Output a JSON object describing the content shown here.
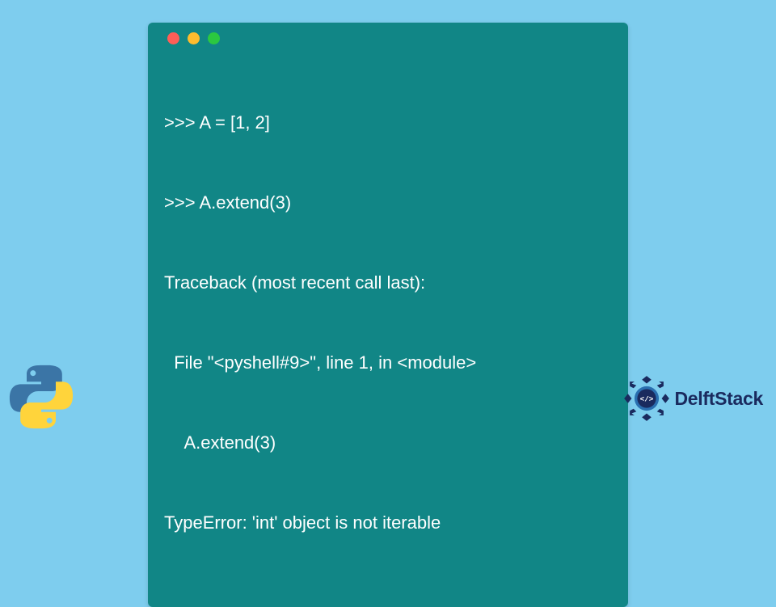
{
  "terminal": {
    "lines": [
      ">>> A = [1, 2]",
      ">>> A.extend(3)",
      "Traceback (most recent call last):",
      "  File \"<pyshell#9>\", line 1, in <module>",
      "    A.extend(3)",
      "TypeError: 'int' object is not iterable"
    ]
  },
  "brand": {
    "name": "DelftStack"
  },
  "colors": {
    "background": "#7ecdee",
    "terminal": "#118686",
    "text": "#ffffff",
    "brand": "#1a2a5e"
  }
}
